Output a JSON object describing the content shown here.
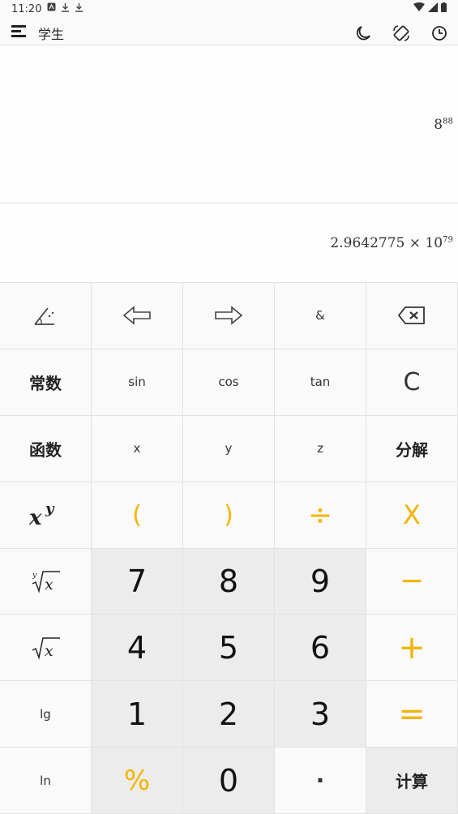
{
  "status": {
    "time": "11:20"
  },
  "app": {
    "title": "学生"
  },
  "expression": {
    "base": "8",
    "exponent": "88"
  },
  "result": {
    "mantissa": "2.9642775 × 10",
    "exponent": "79"
  },
  "keys": {
    "ampersand": "&",
    "constants": "常数",
    "sin": "sin",
    "cos": "cos",
    "tan": "tan",
    "clear": "C",
    "functions": "函数",
    "x": "x",
    "y": "y",
    "z": "z",
    "factorize": "分解",
    "lparen": "(",
    "rparen": ")",
    "divide": "÷",
    "multiply": "X",
    "seven": "7",
    "eight": "8",
    "nine": "9",
    "minus": "−",
    "four": "4",
    "five": "5",
    "six": "6",
    "plus": "+",
    "lg": "lg",
    "one": "1",
    "two": "2",
    "three": "3",
    "equals": "=",
    "ln": "ln",
    "percent": "%",
    "zero": "0",
    "dot": "·",
    "compute": "计算"
  },
  "accent_color": "#f4b400"
}
